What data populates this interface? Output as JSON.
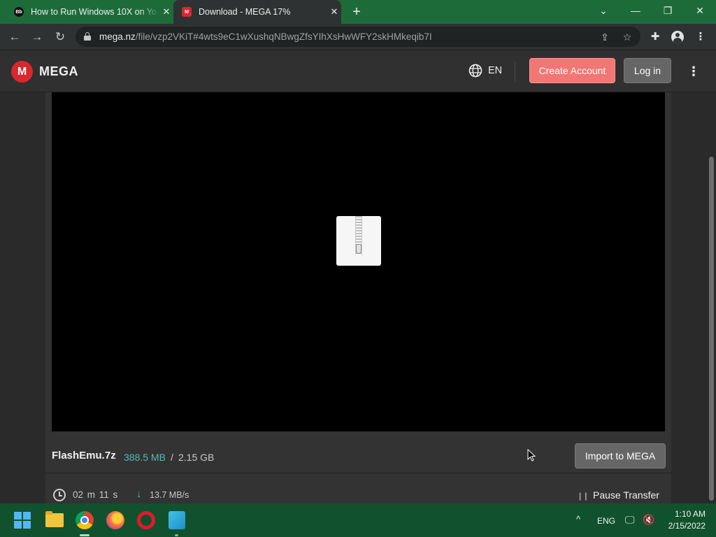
{
  "browser": {
    "tabs": [
      {
        "title": "How to Run Windows 10X on Yo",
        "favicon": "bb-favicon",
        "favicon_text": "Bb",
        "active": false
      },
      {
        "title": "Download - MEGA 17%",
        "favicon": "mega-favicon",
        "favicon_text": "M",
        "active": true
      }
    ],
    "new_tab_label": "+",
    "window_controls": {
      "tab_search": "⌄",
      "minimize": "—",
      "restore": "❐",
      "close": "✕"
    },
    "url_host": "mega.nz",
    "url_path": "/file/vzp2VKiT#4wts9eC1wXushqNBwgZfsYIhXsHwWFY2skHMkeqib7I"
  },
  "mega": {
    "logo_mark": "M",
    "logo_text": "MEGA",
    "language": "EN",
    "create_account_label": "Create Account",
    "login_label": "Log in",
    "accent_color": "#d9272e"
  },
  "file": {
    "name": "FlashEmu.7z",
    "downloaded": "388.5 MB",
    "separator": "/",
    "total": "2.15 GB",
    "import_label": "Import to MEGA",
    "icon": "zip-archive-icon"
  },
  "transfer": {
    "time_remaining": "02 m  11 s",
    "speed": "13.7 MB/s",
    "pause_label": "Pause Transfer",
    "progress_percent": 17
  },
  "taskbar": {
    "apps": [
      "start",
      "file-explorer",
      "chrome",
      "firefox",
      "opera",
      "app"
    ],
    "tray_chevron": "^",
    "language": "ENG",
    "time": "1:10 AM",
    "date": "2/15/2022"
  }
}
